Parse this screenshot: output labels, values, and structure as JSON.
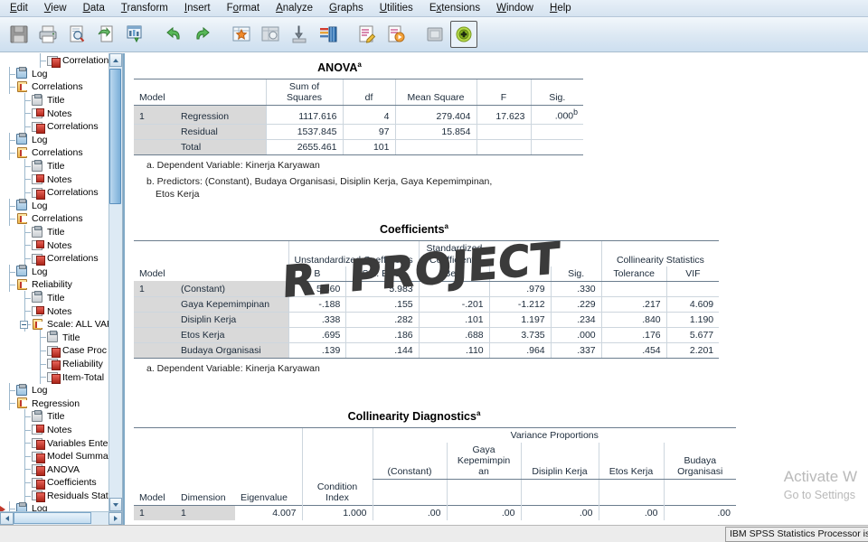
{
  "menu": {
    "items": [
      {
        "label": "Edit",
        "mnemonic": "E"
      },
      {
        "label": "View",
        "mnemonic": "V"
      },
      {
        "label": "Data",
        "mnemonic": "D"
      },
      {
        "label": "Transform",
        "mnemonic": "T"
      },
      {
        "label": "Insert",
        "mnemonic": "I"
      },
      {
        "label": "Format",
        "mnemonic": "o"
      },
      {
        "label": "Analyze",
        "mnemonic": "A"
      },
      {
        "label": "Graphs",
        "mnemonic": "G"
      },
      {
        "label": "Utilities",
        "mnemonic": "U"
      },
      {
        "label": "Extensions",
        "mnemonic": "x"
      },
      {
        "label": "Window",
        "mnemonic": "W"
      },
      {
        "label": "Help",
        "mnemonic": "H"
      }
    ]
  },
  "toolbar": {
    "buttons": [
      {
        "name": "save-icon",
        "title": "Save"
      },
      {
        "name": "print-icon",
        "title": "Print"
      },
      {
        "name": "print-preview-icon",
        "title": "Print Preview"
      },
      {
        "name": "export-icon",
        "title": "Export"
      },
      {
        "name": "insert-chart-icon",
        "title": "Insert Chart"
      },
      {
        "name": "undo-icon",
        "title": "Undo"
      },
      {
        "name": "redo-icon",
        "title": "Redo"
      },
      {
        "name": "goto-data-icon",
        "title": "Go to Data"
      },
      {
        "name": "goto-case-icon",
        "title": "Go to Case"
      },
      {
        "name": "insert-footnote-icon",
        "title": "Insert Footnote"
      },
      {
        "name": "variables-icon",
        "title": "Variables"
      },
      {
        "name": "edit-output-icon",
        "title": "Edit Output"
      },
      {
        "name": "run-icon",
        "title": "Run"
      },
      {
        "name": "dialog-recall-icon",
        "title": "Dialog Recall"
      },
      {
        "name": "add-note-icon",
        "title": "Add Note"
      }
    ]
  },
  "outline": {
    "nodes": [
      {
        "label": "Correlations",
        "icon": "table-icon",
        "depth": 2,
        "expander": false,
        "arrow": false
      },
      {
        "label": "Log",
        "icon": "log-icon",
        "depth": 0,
        "expander": false,
        "arrow": false
      },
      {
        "label": "Correlations",
        "icon": "output-icon",
        "depth": 0,
        "expander": false,
        "arrow": false
      },
      {
        "label": "Title",
        "icon": "title-icon",
        "depth": 1,
        "expander": false,
        "arrow": false
      },
      {
        "label": "Notes",
        "icon": "notes-icon",
        "depth": 1,
        "expander": false,
        "arrow": false
      },
      {
        "label": "Correlations",
        "icon": "table-icon",
        "depth": 1,
        "expander": false,
        "arrow": false
      },
      {
        "label": "Log",
        "icon": "log-icon",
        "depth": 0,
        "expander": false,
        "arrow": false
      },
      {
        "label": "Correlations",
        "icon": "output-icon",
        "depth": 0,
        "expander": false,
        "arrow": false
      },
      {
        "label": "Title",
        "icon": "title-icon",
        "depth": 1,
        "expander": false,
        "arrow": false
      },
      {
        "label": "Notes",
        "icon": "notes-icon",
        "depth": 1,
        "expander": false,
        "arrow": false
      },
      {
        "label": "Correlations",
        "icon": "table-icon",
        "depth": 1,
        "expander": false,
        "arrow": false
      },
      {
        "label": "Log",
        "icon": "log-icon",
        "depth": 0,
        "expander": false,
        "arrow": false
      },
      {
        "label": "Correlations",
        "icon": "output-icon",
        "depth": 0,
        "expander": false,
        "arrow": false
      },
      {
        "label": "Title",
        "icon": "title-icon",
        "depth": 1,
        "expander": false,
        "arrow": false
      },
      {
        "label": "Notes",
        "icon": "notes-icon",
        "depth": 1,
        "expander": false,
        "arrow": false
      },
      {
        "label": "Correlations",
        "icon": "table-icon",
        "depth": 1,
        "expander": false,
        "arrow": false
      },
      {
        "label": "Log",
        "icon": "log-icon",
        "depth": 0,
        "expander": false,
        "arrow": false
      },
      {
        "label": "Reliability",
        "icon": "output-icon",
        "depth": 0,
        "expander": false,
        "arrow": false
      },
      {
        "label": "Title",
        "icon": "title-icon",
        "depth": 1,
        "expander": false,
        "arrow": false
      },
      {
        "label": "Notes",
        "icon": "notes-icon",
        "depth": 1,
        "expander": false,
        "arrow": false
      },
      {
        "label": "Scale: ALL VAR",
        "icon": "output-icon",
        "depth": 1,
        "expander": true,
        "arrow": false
      },
      {
        "label": "Title",
        "icon": "title-icon",
        "depth": 2,
        "expander": false,
        "arrow": false
      },
      {
        "label": "Case Proc",
        "icon": "table-icon",
        "depth": 2,
        "expander": false,
        "arrow": false
      },
      {
        "label": "Reliability",
        "icon": "table-icon",
        "depth": 2,
        "expander": false,
        "arrow": false
      },
      {
        "label": "Item-Total",
        "icon": "table-icon",
        "depth": 2,
        "expander": false,
        "arrow": false
      },
      {
        "label": "Log",
        "icon": "log-icon",
        "depth": 0,
        "expander": false,
        "arrow": false
      },
      {
        "label": "Regression",
        "icon": "output-icon",
        "depth": 0,
        "expander": false,
        "arrow": false
      },
      {
        "label": "Title",
        "icon": "title-icon",
        "depth": 1,
        "expander": false,
        "arrow": false
      },
      {
        "label": "Notes",
        "icon": "notes-icon",
        "depth": 1,
        "expander": false,
        "arrow": false
      },
      {
        "label": "Variables Enter",
        "icon": "table-icon",
        "depth": 1,
        "expander": false,
        "arrow": false
      },
      {
        "label": "Model Summar",
        "icon": "table-icon",
        "depth": 1,
        "expander": false,
        "arrow": false
      },
      {
        "label": "ANOVA",
        "icon": "table-icon",
        "depth": 1,
        "expander": false,
        "arrow": false
      },
      {
        "label": "Coefficients",
        "icon": "table-icon",
        "depth": 1,
        "expander": false,
        "arrow": false
      },
      {
        "label": "Residuals Stati",
        "icon": "table-icon",
        "depth": 1,
        "expander": false,
        "arrow": false
      },
      {
        "label": "Log",
        "icon": "log-icon",
        "depth": 0,
        "expander": false,
        "arrow": true
      }
    ]
  },
  "anova": {
    "title": "ANOVA",
    "title_sup": "a",
    "col_model": "Model",
    "headers": [
      "Sum of\nSquares",
      "df",
      "Mean Square",
      "F",
      "Sig."
    ],
    "headers_flat": [
      "Sum of",
      "Squares",
      "df",
      "Mean Square",
      "F",
      "Sig."
    ],
    "h_sum1": "Sum of",
    "h_sum2": "Squares",
    "h_df": "df",
    "h_ms": "Mean Square",
    "h_f": "F",
    "h_sig": "Sig.",
    "model_number": "1",
    "rows": [
      {
        "label": "Regression",
        "ss": "1117.616",
        "df": "4",
        "ms": "279.404",
        "f": "17.623",
        "sig": ".000",
        "sig_sup": "b"
      },
      {
        "label": "Residual",
        "ss": "1537.845",
        "df": "97",
        "ms": "15.854",
        "f": "",
        "sig": "",
        "sig_sup": ""
      },
      {
        "label": "Total",
        "ss": "2655.461",
        "df": "101",
        "ms": "",
        "f": "",
        "sig": "",
        "sig_sup": ""
      }
    ],
    "footnote_a": "a. Dependent Variable: Kinerja Karyawan",
    "footnote_b": "b. Predictors: (Constant), Budaya Organisasi, Disiplin Kerja, Gaya Kepemimpinan,",
    "footnote_b_cont": "Etos Kerja"
  },
  "coefficients": {
    "title": "Coefficients",
    "title_sup": "a",
    "col_model": "Model",
    "group_unstd": "Unstandardized Coefficients",
    "group_std1": "Standardized",
    "group_std2": "Coefficients",
    "group_collin": "Collinearity Statistics",
    "h_b": "B",
    "h_se": "Std. Error",
    "h_beta": "Beta",
    "h_t": "t",
    "h_sig": "Sig.",
    "h_tol": "Tolerance",
    "h_vif": "VIF",
    "model_number": "1",
    "rows": [
      {
        "label": "(Constant)",
        "b": "5.860",
        "se": "5.983",
        "beta": "",
        "t": ".979",
        "sig": ".330",
        "tol": "",
        "vif": ""
      },
      {
        "label": "Gaya Kepemimpinan",
        "b": "-.188",
        "se": ".155",
        "beta": "-.201",
        "t": "-1.212",
        "sig": ".229",
        "tol": ".217",
        "vif": "4.609"
      },
      {
        "label": "Disiplin Kerja",
        "b": ".338",
        "se": ".282",
        "beta": ".101",
        "t": "1.197",
        "sig": ".234",
        "tol": ".840",
        "vif": "1.190"
      },
      {
        "label": "Etos Kerja",
        "b": ".695",
        "se": ".186",
        "beta": ".688",
        "t": "3.735",
        "sig": ".000",
        "tol": ".176",
        "vif": "5.677"
      },
      {
        "label": "Budaya Organisasi",
        "b": ".139",
        "se": ".144",
        "beta": ".110",
        "t": ".964",
        "sig": ".337",
        "tol": ".454",
        "vif": "2.201"
      }
    ],
    "footnote_a": "a. Dependent Variable: Kinerja Karyawan"
  },
  "collinearity": {
    "title": "Collinearity Diagnostics",
    "title_sup": "a",
    "group_variance": "Variance Proportions",
    "h_model": "Model",
    "h_dimension": "Dimension",
    "h_eigenvalue": "Eigenvalue",
    "h_cond1": "Condition",
    "h_cond2": "Index",
    "h_constant": "(Constant)",
    "h_gaya1": "Gaya",
    "h_gaya2": "Kepemimpin",
    "h_gaya3": "an",
    "h_disiplin": "Disiplin Kerja",
    "h_etos": "Etos Kerja",
    "h_budaya1": "Budaya",
    "h_budaya2": "Organisasi",
    "rows": [
      {
        "model": "1",
        "dim": "1",
        "eigen": "4.007",
        "cond": "1.000",
        "constant": ".00",
        "gaya": ".00",
        "disiplin": ".00",
        "etos": ".00",
        "budaya": ".00"
      }
    ]
  },
  "watermarks": {
    "project": "R. PROJECT",
    "activate_line1": "Activate W",
    "activate_line2": "Go to Settings"
  },
  "statusbar": {
    "message": "IBM SPSS Statistics Processor is"
  },
  "colors": {
    "menu_bg": "#d6e3f0",
    "toolbar_bg": "#dce8f3",
    "row_header_bg": "#d9d9d9",
    "table_rule": "#6b7d8e",
    "scroll_thumb": "#7aaed8",
    "watermark": "#3b3b3b"
  }
}
